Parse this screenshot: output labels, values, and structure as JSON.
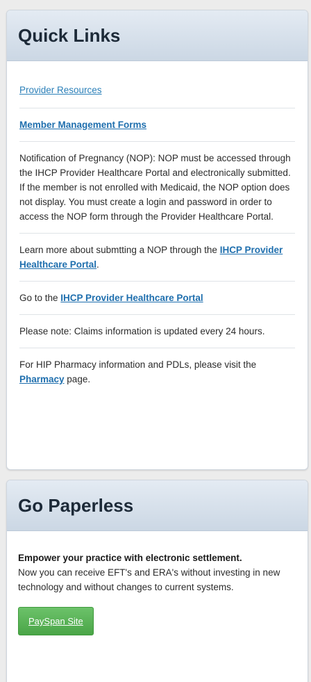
{
  "quick_links": {
    "title": "Quick Links",
    "provider_resources": "Provider Resources",
    "member_management_forms": "Member Management Forms",
    "nop_text": "Notification of Pregnancy (NOP): NOP must be accessed through the IHCP Provider Healthcare Portal and electronically submitted. If the member is not enrolled with Medicaid, the NOP option does not display. You must create a login and password in order to access the NOP form through the Provider Healthcare Portal.",
    "learn_more_prefix": "Learn more about submtting a NOP through the ",
    "learn_more_link": "IHCP Provider Healthcare Portal",
    "learn_more_suffix": ".",
    "goto_prefix": "Go to the ",
    "goto_link": "IHCP Provider Healthcare Portal",
    "claims_note": "Please note: Claims information is updated every 24 hours.",
    "pharmacy_prefix": "For HIP Pharmacy information and PDLs, please visit the ",
    "pharmacy_link": "Pharmacy",
    "pharmacy_suffix": " page."
  },
  "go_paperless": {
    "title": "Go Paperless",
    "headline": "Empower your practice with electronic settlement.",
    "body": "Now you can receive EFT's and ERA's without investing in new technology and without changes to current systems.",
    "button": "PaySpan Site"
  },
  "colors": {
    "link": "#2a7fb8",
    "header_gradient_top": "#e4ebf3",
    "header_gradient_bottom": "#cbd7e4",
    "button_green": "#4aa547"
  }
}
